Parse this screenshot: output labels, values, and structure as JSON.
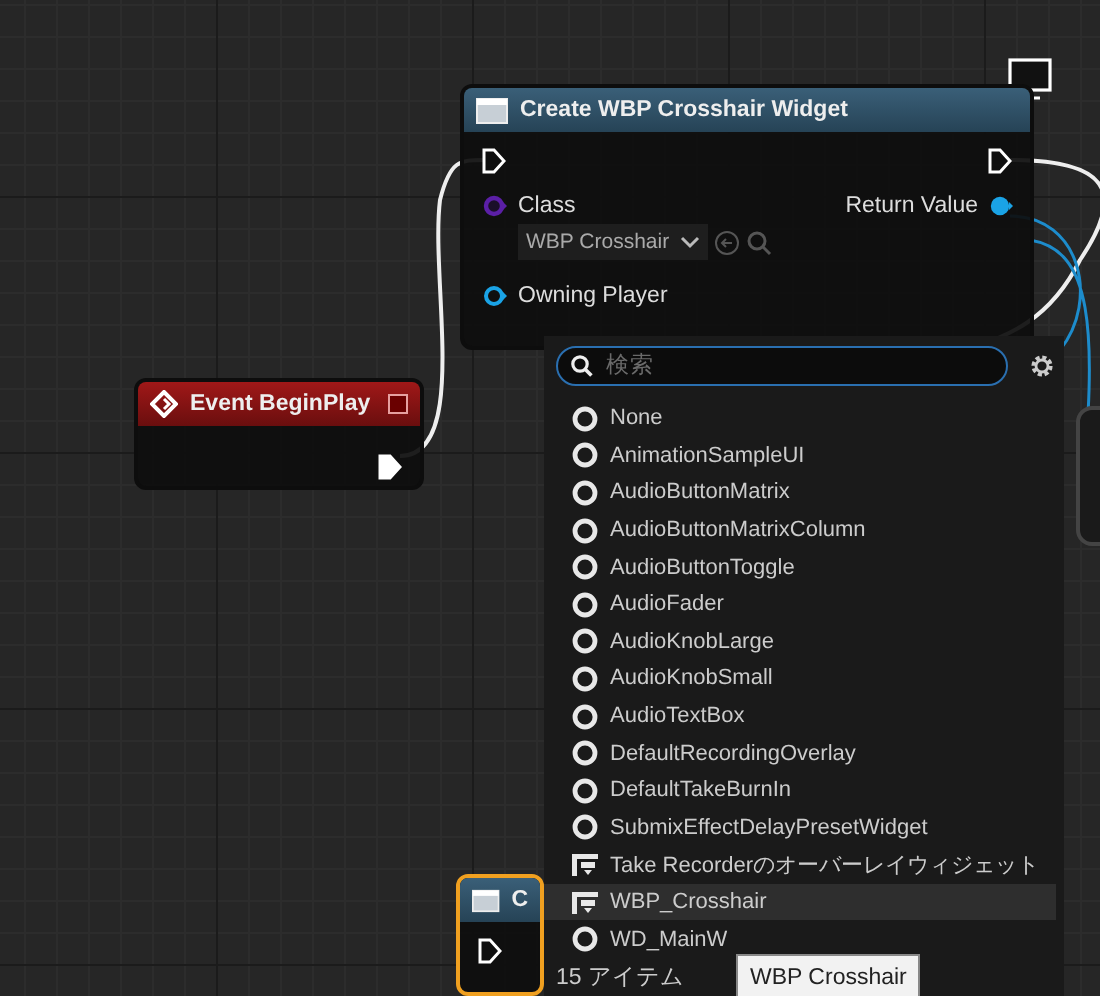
{
  "graph": {
    "nodes": [
      {
        "kind": "function",
        "title": "Create WBP Crosshair Widget",
        "selected": false,
        "inputs": [
          {
            "label": "Class",
            "kind": "class",
            "value": "WBP Crosshair"
          },
          {
            "label": "Owning Player",
            "kind": "object"
          }
        ],
        "outputs": [
          {
            "label": "Return Value",
            "kind": "linked"
          }
        ]
      },
      {
        "kind": "event",
        "title": "Event BeginPlay",
        "selected": false
      },
      {
        "kind": "function",
        "title": "C",
        "selected": true
      }
    ]
  },
  "picker": {
    "search": {
      "placeholder": "検索"
    },
    "items": [
      {
        "label": "None",
        "kind": "class",
        "selected": false
      },
      {
        "label": "AnimationSampleUI",
        "kind": "class",
        "selected": false
      },
      {
        "label": "AudioButtonMatrix",
        "kind": "class",
        "selected": false
      },
      {
        "label": "AudioButtonMatrixColumn",
        "kind": "class",
        "selected": false
      },
      {
        "label": "AudioButtonToggle",
        "kind": "class",
        "selected": false
      },
      {
        "label": "AudioFader",
        "kind": "class",
        "selected": false
      },
      {
        "label": "AudioKnobLarge",
        "kind": "class",
        "selected": false
      },
      {
        "label": "AudioKnobSmall",
        "kind": "class",
        "selected": false
      },
      {
        "label": "AudioTextBox",
        "kind": "class",
        "selected": false
      },
      {
        "label": "DefaultRecordingOverlay",
        "kind": "class",
        "selected": false
      },
      {
        "label": "DefaultTakeBurnIn",
        "kind": "class",
        "selected": false
      },
      {
        "label": "SubmixEffectDelayPresetWidget",
        "kind": "class",
        "selected": false
      },
      {
        "label": "Take Recorderのオーバーレイウィジェット",
        "kind": "widget",
        "selected": false
      },
      {
        "label": "WBP_Crosshair",
        "kind": "widget",
        "selected": true
      },
      {
        "label": "WD_MainW",
        "kind": "class",
        "selected": false
      }
    ],
    "count": "15 アイテム",
    "tooltip": "WBP Crosshair"
  }
}
